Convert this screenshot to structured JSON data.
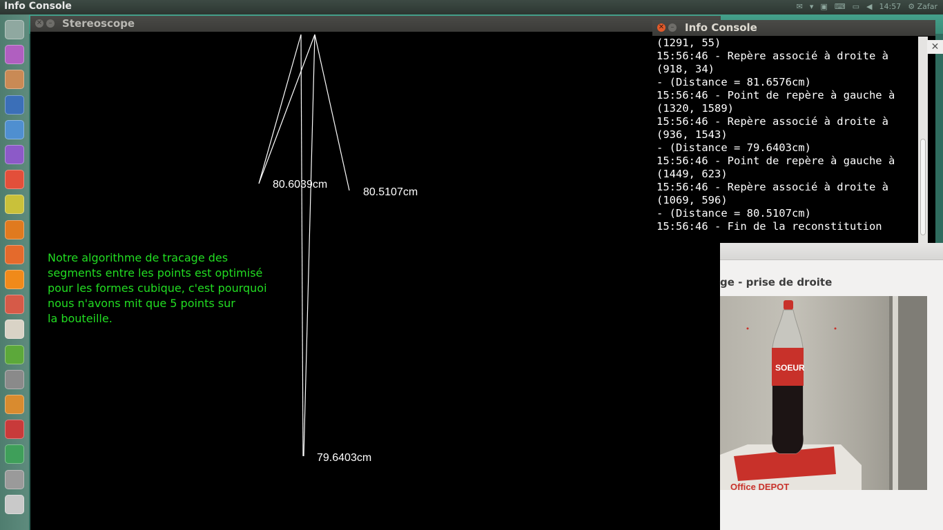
{
  "top_panel": {
    "title": "Info Console",
    "tray": [
      "✉",
      "▾",
      "▣",
      "⌨",
      "▭",
      "◀",
      "14:57",
      "⚙ Zafar"
    ]
  },
  "launcher": {
    "icons": [
      {
        "name": "dash-home-icon",
        "color": "#8fa8a0"
      },
      {
        "name": "purple-app-icon",
        "color": "#b05fc0"
      },
      {
        "name": "files-icon",
        "color": "#c98a55"
      },
      {
        "name": "browser-icon",
        "color": "#3b6fb8"
      },
      {
        "name": "document-icon",
        "color": "#4f8fd0"
      },
      {
        "name": "purple-tool-icon",
        "color": "#8c5ac8"
      },
      {
        "name": "colorful-app-icon",
        "color": "#e34f3a"
      },
      {
        "name": "yellow-app-icon",
        "color": "#c9c13a"
      },
      {
        "name": "firefox-icon",
        "color": "#e07a1f"
      },
      {
        "name": "software-center-icon",
        "color": "#e46a2c"
      },
      {
        "name": "vlc-icon",
        "color": "#f08a1a"
      },
      {
        "name": "tools-icon",
        "color": "#d65a48"
      },
      {
        "name": "text-editor-icon",
        "color": "#d9d3c6"
      },
      {
        "name": "green-app-icon",
        "color": "#5ca83a"
      },
      {
        "name": "settings-icon",
        "color": "#8a8a8a"
      },
      {
        "name": "archive-icon",
        "color": "#d98b2f"
      },
      {
        "name": "red-app-icon",
        "color": "#c83a3a"
      },
      {
        "name": "green-terminal-icon",
        "color": "#3f9f5a"
      },
      {
        "name": "drive-icon",
        "color": "#9a9a9a"
      },
      {
        "name": "trash-icon",
        "color": "#c9c9c9"
      }
    ]
  },
  "stereoscope": {
    "title": "Stereoscope",
    "labels": [
      "80.6039cm",
      "80.5107cm",
      "79.6403cm"
    ],
    "note": [
      "Notre algorithme de tracage des",
      "segments entre les points est optimisé",
      "pour les formes cubique, c'est pourquoi",
      "nous n'avons mit que 5 points sur",
      "la bouteille."
    ],
    "colors": {
      "background": "#000000",
      "lines": "#ffffff",
      "note": "#22dd22"
    }
  },
  "console": {
    "title": "Info Console",
    "lines": [
      "(1291, 55)",
      "15:56:46 - Repère associé à droite à",
      "(918, 34)",
      "- (Distance = 81.6576cm)",
      "15:56:46 - Point de repère à gauche à",
      "(1320, 1589)",
      "15:56:46 - Repère associé à droite à",
      "(936, 1543)",
      "- (Distance = 79.6403cm)",
      "15:56:46 - Point de repère à gauche à",
      "(1449, 623)",
      "15:56:46 - Repère associé à droite à",
      "(1069, 596)",
      "- (Distance = 80.5107cm)",
      "15:56:46 - Fin de la reconstitution"
    ]
  },
  "viewer": {
    "caption": "ge - prise de droite",
    "photo_text": [
      "SOEUR",
      "Office DEPOT"
    ]
  }
}
